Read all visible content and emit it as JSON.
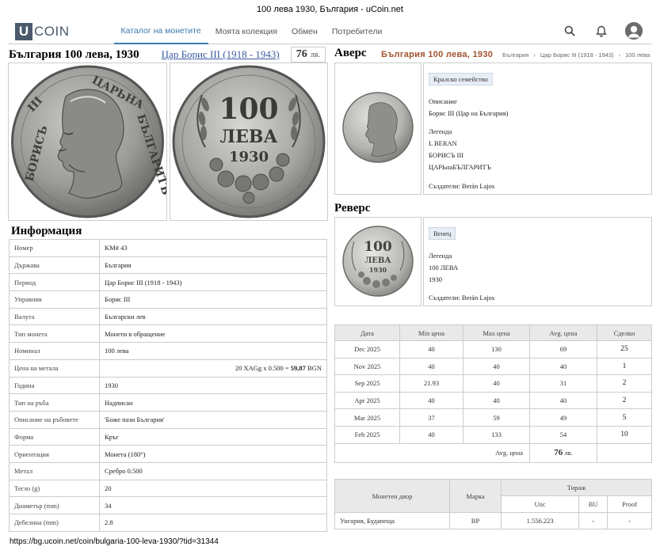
{
  "window": {
    "title": "100 лева 1930, България - uCoin.net"
  },
  "header": {
    "logo_letter": "U",
    "logo_text": "COIN",
    "nav": [
      {
        "label": "Каталог на монетите",
        "active": true
      },
      {
        "label": "Моята колекция"
      },
      {
        "label": "Обмен"
      },
      {
        "label": "Потребители"
      }
    ],
    "icons": [
      "search-icon",
      "bell-icon",
      "user-avatar-icon"
    ]
  },
  "coin": {
    "title": "България 100 лева, 1930",
    "ruler_link": "Цар Борис III (1918 - 1943)",
    "price_value": "76",
    "price_currency": "лв."
  },
  "photo": {
    "obverse_legend": "БОРИСЪ III ЦАРЬНАБЪЛГАРИТЪ",
    "reverse_value": "100",
    "reverse_unit": "ЛЕВА",
    "reverse_year": "1930"
  },
  "obverse": {
    "heading": "Аверс",
    "breadcrumb_main": "България 100 лева, 1930",
    "breadcrumbs": [
      "България",
      "Цар Борис III (1918 - 1943)",
      "100 лева"
    ],
    "breadcrumb_sep": "›",
    "tag": "Кралско семейство",
    "desc_label": "Описание",
    "desc_value": "Борис III (Цар на България)",
    "legend_label": "Легенда",
    "legend_lines": [
      "L BERAN",
      "БОРИСЪ III",
      "ЦАРЬнаБЪЛГАРИТЪ"
    ],
    "creators": "Създатели: Berán Lajos"
  },
  "reverse": {
    "heading": "Реверс",
    "tag": "Венец",
    "legend_label": "Легенда",
    "legend_lines": [
      "100 ЛЕВА",
      "1930"
    ],
    "creators": "Създатели: Berán Lajos"
  },
  "info": {
    "heading": "Информация",
    "rows": [
      {
        "key": "Номер",
        "value": "KM# 43"
      },
      {
        "key": "Държава",
        "value": "България"
      },
      {
        "key": "Период",
        "value": "Цар Борис III (1918 - 1943)"
      },
      {
        "key": "Управник",
        "value": "Борис III"
      },
      {
        "key": "Валута",
        "value": "Български лев"
      },
      {
        "key": "Тип монета",
        "value": "Монети в обращение"
      },
      {
        "key": "Номинал",
        "value": "100 лева"
      },
      {
        "key": "Цена на метала",
        "value": "20 XAGg x 0.500 =",
        "value_bold": "59,87",
        "value_tail": "BGN"
      },
      {
        "key": "Година",
        "value": "1930"
      },
      {
        "key": "Тип на ръба",
        "value": "Надписан"
      },
      {
        "key": "Описание на ръбовете",
        "value": "'Боже пази България'"
      },
      {
        "key": "Форма",
        "value": "Кръг"
      },
      {
        "key": "Ориентация",
        "value": "Монета (180°)"
      },
      {
        "key": "Метал",
        "value": "Сребро 0.500"
      },
      {
        "key": "Тегло (g)",
        "value": "20"
      },
      {
        "key": "Диаметър (mm)",
        "value": "34"
      },
      {
        "key": "Дебелина (mm)",
        "value": "2.8"
      }
    ]
  },
  "prices": {
    "headers": [
      "Дата",
      "Min цена",
      "Max цена",
      "Avg. цена",
      "Сделки"
    ],
    "rows": [
      [
        "Dec 2025",
        "40",
        "130",
        "69",
        "25"
      ],
      [
        "Nov 2025",
        "40",
        "40",
        "40",
        "1"
      ],
      [
        "Sep 2025",
        "21.93",
        "40",
        "31",
        "2"
      ],
      [
        "Apr 2025",
        "40",
        "40",
        "40",
        "2"
      ],
      [
        "Mar 2025",
        "37",
        "59",
        "49",
        "5"
      ],
      [
        "Feb 2025",
        "40",
        "133",
        "54",
        "10"
      ]
    ],
    "avg_label": "Avg. цена",
    "avg_value": "76",
    "avg_currency": "лв."
  },
  "mintage": {
    "mint_header": "Монетен двор",
    "mark_header": "Марка",
    "tirage_header": "Тираж",
    "sub_headers": [
      "Unc",
      "BU",
      "Proof"
    ],
    "rows": [
      [
        "Унгария, Будапеща",
        "BP",
        "1.556.223",
        "-",
        "-"
      ]
    ]
  },
  "status": {
    "url": "https://bg.ucoin.net/coin/bulgaria-100-leva-1930/?tid=31344"
  },
  "colors": {
    "accent": "#3a7ab0",
    "brand": "#4a5a6a",
    "crumb": "#a0522d"
  }
}
